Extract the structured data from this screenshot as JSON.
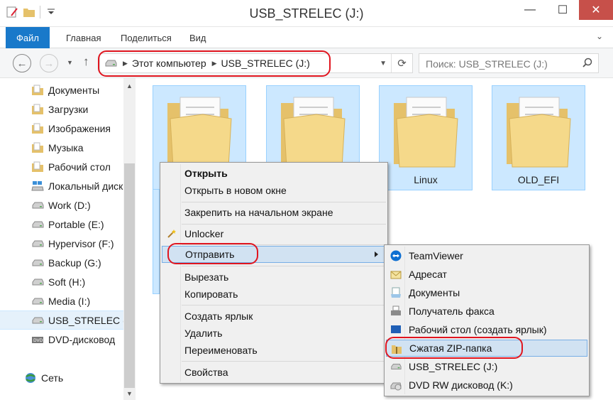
{
  "window": {
    "title": "USB_STRELEC (J:)",
    "minimize": "—",
    "maximize": "☐",
    "close": "✕"
  },
  "ribbon": {
    "file_tab": "Файл",
    "tabs": [
      "Главная",
      "Поделиться",
      "Вид"
    ],
    "expand_glyph": "⌄"
  },
  "address": {
    "crumbs": [
      "Этот компьютер",
      "USB_STRELEC (J:)"
    ],
    "search_placeholder": "Поиск: USB_STRELEC (J:)"
  },
  "nav_pane": {
    "items": [
      {
        "label": "Документы",
        "icon": "documents-folder-icon"
      },
      {
        "label": "Загрузки",
        "icon": "downloads-folder-icon"
      },
      {
        "label": "Изображения",
        "icon": "pictures-folder-icon"
      },
      {
        "label": "Музыка",
        "icon": "music-folder-icon"
      },
      {
        "label": "Рабочий стол",
        "icon": "desktop-folder-icon"
      },
      {
        "label": "Локальный диск",
        "icon": "windows-drive-icon"
      },
      {
        "label": "Work (D:)",
        "icon": "drive-icon"
      },
      {
        "label": "Portable (E:)",
        "icon": "drive-icon"
      },
      {
        "label": "Hypervisor (F:)",
        "icon": "drive-icon"
      },
      {
        "label": "Backup (G:)",
        "icon": "drive-icon"
      },
      {
        "label": "Soft (H:)",
        "icon": "drive-icon"
      },
      {
        "label": "Media (I:)",
        "icon": "drive-icon"
      },
      {
        "label": "USB_STRELEC (J:)",
        "icon": "usb-drive-icon",
        "selected": true
      },
      {
        "label": "DVD-дисковод",
        "icon": "dvd-drive-icon"
      }
    ],
    "network": "Сеть"
  },
  "folders": [
    {
      "label": ""
    },
    {
      "label": ""
    },
    {
      "label": "Linux"
    },
    {
      "label": "OLD_EFI"
    }
  ],
  "context_menu": {
    "items": [
      "Открыть",
      "Открыть в новом окне",
      "Закрепить на начальном экране",
      "Unlocker",
      "Отправить",
      "Вырезать",
      "Копировать",
      "Создать ярлык",
      "Удалить",
      "Переименовать",
      "Свойства"
    ]
  },
  "send_to_menu": {
    "items": [
      "TeamViewer",
      "Адресат",
      "Документы",
      "Получатель факса",
      "Рабочий стол (создать ярлык)",
      "Сжатая ZIP-папка",
      "USB_STRELEC (J:)",
      "DVD RW дисковод (K:)"
    ]
  },
  "colors": {
    "accent": "#1979ca",
    "highlight_ring": "#e0151f",
    "selection": "#cce8ff",
    "close_button": "#c7504a"
  }
}
